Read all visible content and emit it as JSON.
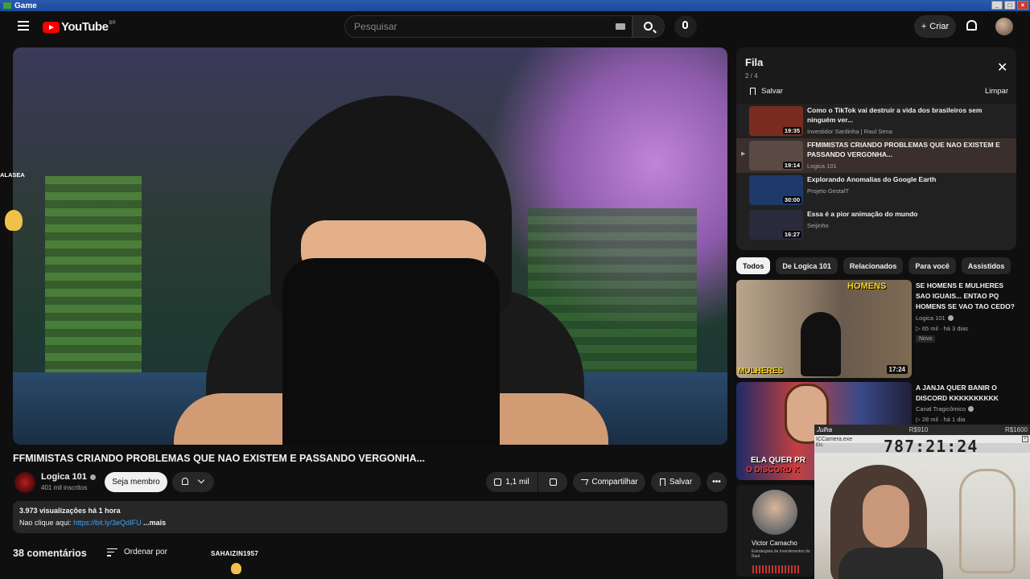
{
  "window": {
    "title": "Game"
  },
  "header": {
    "logo_text": "YouTube",
    "country_code": "BR",
    "search_placeholder": "Pesquisar",
    "create_label": "Criar"
  },
  "video": {
    "title": "FFMIMISTAS CRIANDO PROBLEMAS QUE NAO EXISTEM E PASSANDO VERGONHA...",
    "channel": "Logica 101",
    "subscribers": "401 mil inscritos",
    "member_label": "Seja membro",
    "likes": "1,1 mil",
    "share_label": "Compartilhar",
    "save_label": "Salvar",
    "more_label": "•••",
    "views": "3.973 visualizações",
    "age": "há 1 hora",
    "desc_prefix": "Nao clique aqui:",
    "desc_link": "https://bit.ly/3eQdIFU",
    "desc_more": "...mais"
  },
  "comments": {
    "count_label": "38 comentários",
    "sort_label": "Ordenar por"
  },
  "overlays": {
    "stream_name": "SAHAIZIN1957",
    "side_label": "ALASEA"
  },
  "queue": {
    "title": "Fila",
    "position": "2 / 4",
    "save_label": "Salvar",
    "clear_label": "Limpar",
    "items": [
      {
        "title": "Como o TikTok vai destruir a vida dos brasileiros sem ninguém ver...",
        "channel": "Investidor Sardinha | Raul Sena",
        "duration": "19:35",
        "active": false,
        "color": "#7a2b1f"
      },
      {
        "title": "FFMIMISTAS CRIANDO PROBLEMAS QUE NAO EXISTEM E PASSANDO VERGONHA...",
        "channel": "Logica 101",
        "duration": "19:14",
        "active": true,
        "color": "#5a4a44"
      },
      {
        "title": "Explorando Anomalias do Google Earth",
        "channel": "Projeto GestalT",
        "duration": "30:00",
        "active": false,
        "color": "#1d3a6a"
      },
      {
        "title": "Essa é a pior animação do mundo",
        "channel": "Seijinho",
        "duration": "16:27",
        "active": false,
        "color": "#2a2a3a"
      }
    ]
  },
  "chips": [
    "Todos",
    "De Logica 101",
    "Relacionados",
    "Para você",
    "Assistidos"
  ],
  "recommendations": [
    {
      "title": "SE HOMENS E MULHERES SAO IGUAIS... ENTAO PQ HOMENS SE VAO TAO CEDO?",
      "channel": "Logica 101",
      "views": "65 mil",
      "age": "há 3 dias",
      "badge": "Novo",
      "duration": "17:24",
      "thumb_top_text": "HOMENS",
      "thumb_bottom_text": "MULHERES"
    },
    {
      "title": "A JANJA QUER BANIR O DISCORD KKKKKKKKKK",
      "channel": "Canal Tragicômico",
      "views": "28 mil",
      "age": "há 1 dia",
      "thumb_text_1": "ELA QUER PR",
      "thumb_text_2": "O DISCORD K"
    },
    {
      "thumb_name": "Victor Camacho",
      "thumb_sub": "Estrategista de Investimentos do Raul"
    }
  ],
  "webcam": {
    "user": "Julha",
    "amount_1": "R$910",
    "amount_2": "R$1600",
    "window_title": "ICCamera.exe",
    "sub_label": "Etc",
    "timer": "787:21:24"
  },
  "colors": {
    "accent": "#ff0000",
    "link": "#3ea6ff",
    "background": "#0f0f0f"
  }
}
